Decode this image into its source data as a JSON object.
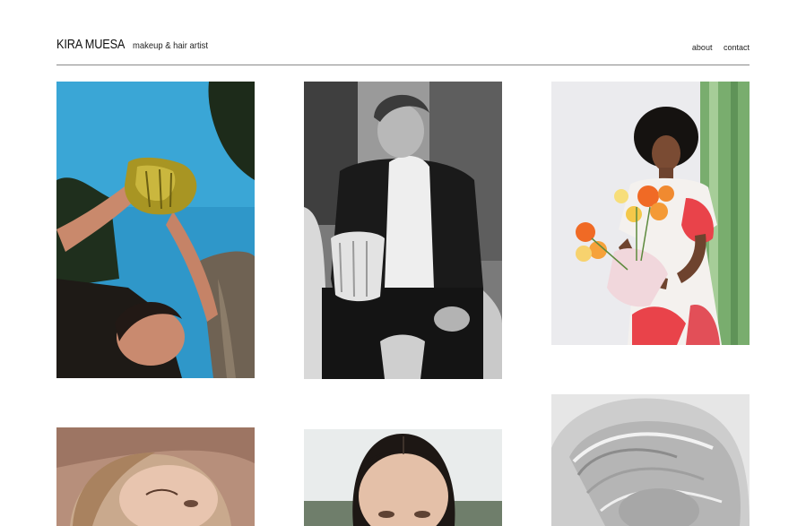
{
  "site": {
    "name": "KIRA MUESA",
    "tagline": "makeup & hair artist"
  },
  "nav": {
    "about": "about",
    "contact": "contact"
  },
  "gallery": {
    "items": [
      {
        "name": "gallery-photo-1",
        "subject": "woman holding gold glass vase against blue sky"
      },
      {
        "name": "gallery-photo-2",
        "subject": "black and white portrait, man in suit with crystal vase"
      },
      {
        "name": "gallery-photo-3",
        "subject": "woman with afro holding orange flowers"
      },
      {
        "name": "gallery-photo-4",
        "subject": "close-up portrait, woman with slicked hair, warm background"
      },
      {
        "name": "gallery-photo-5",
        "subject": "portrait with center-parted dark hair"
      },
      {
        "name": "gallery-photo-6",
        "subject": "black and white close-up of blonde hair"
      }
    ]
  },
  "colors": {
    "background": "#ffffff",
    "rule": "#8a8a8a",
    "sky": "#2f97c9",
    "gold_vase": "#b3a12a",
    "green_paper": "#79ad6e",
    "coral": "#e9434a"
  }
}
